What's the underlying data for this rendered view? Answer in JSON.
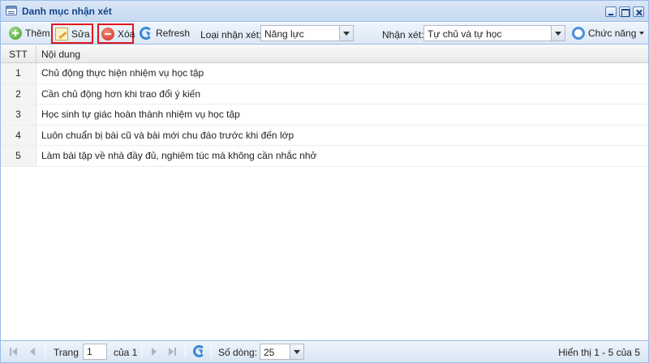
{
  "window": {
    "title": "Danh mục nhận xét"
  },
  "toolbar": {
    "add_label": "Thêm",
    "edit_label": "Sửa",
    "delete_label": "Xóa",
    "refresh_label": "Refresh",
    "category_label": "Loại nhận xét:",
    "category_value": "Năng lực",
    "comment_label": "Nhận xét:",
    "comment_value": "Tự chủ và tự học",
    "functions_label": "Chức năng"
  },
  "grid": {
    "columns": [
      "STT",
      "Nội dung"
    ],
    "rows": [
      {
        "stt": "1",
        "content": "Chủ động thực hiện nhiệm vụ học tập"
      },
      {
        "stt": "2",
        "content": "Cần chủ động hơn khi trao đổi ý kiến"
      },
      {
        "stt": "3",
        "content": "Học sinh tự giác hoàn thành nhiệm vụ học tập"
      },
      {
        "stt": "4",
        "content": "Luôn chuẩn bị bài cũ và bài mới chu đáo trước khi đến lớp"
      },
      {
        "stt": "5",
        "content": "Làm bài tập về nhà đầy đủ, nghiêm túc mà không cần nhắc nhở"
      }
    ]
  },
  "paging": {
    "page_label": "Trang",
    "page_value": "1",
    "of_label": "của 1",
    "rows_label": "Số dòng:",
    "rows_value": "25",
    "summary": "Hiển thị 1 - 5 của 5"
  },
  "colors": {
    "header_text": "#15428b",
    "highlight_border": "#e0141e",
    "frame_border": "#99bbe8"
  }
}
